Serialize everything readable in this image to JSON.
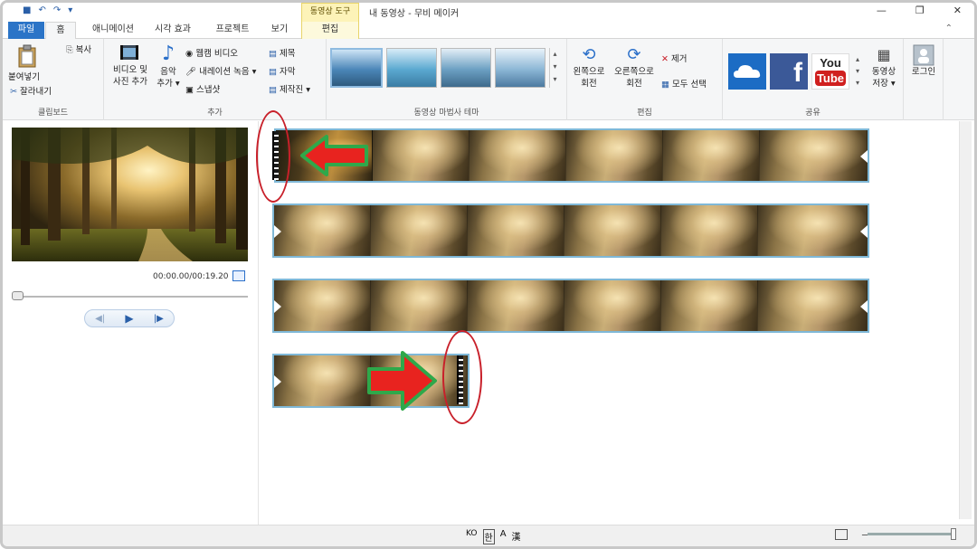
{
  "window": {
    "title": "내 동영상 - 무비 메이커",
    "tool_tab_header": "동영상 도구",
    "minimize": "—",
    "restore": "❐",
    "close": "✕",
    "collapse_ribbon": "⌃"
  },
  "quick_access": {
    "save": "■",
    "undo": "↶",
    "redo": "↷",
    "customize": "▾"
  },
  "tabs": {
    "file": "파일",
    "home": "홈",
    "animation": "애니메이션",
    "visual_effects": "시각 효과",
    "project": "프로젝트",
    "view": "보기",
    "edit": "편집"
  },
  "ribbon": {
    "clipboard": {
      "label": "클립보드",
      "paste": "붙여넣기",
      "copy": "복사",
      "cut": "잘라내기"
    },
    "add": {
      "label": "추가",
      "add_video_photo_1": "비디오 및",
      "add_video_photo_2": "사진 추가",
      "music_1": "음악",
      "music_2": "추가 ▾",
      "webcam": "웹캠 비디오",
      "narration": "내레이션 녹음 ▾",
      "snapshot": "스냅샷",
      "title": "제목",
      "caption": "자막",
      "credits": "제작진 ▾"
    },
    "themes": {
      "label": "동영상 마법사 테마"
    },
    "editing": {
      "label": "편집",
      "rotate_left_1": "왼쪽으로",
      "rotate_left_2": "회전",
      "rotate_right_1": "오른쪽으로",
      "rotate_right_2": "회전",
      "remove": "제거",
      "select_all": "모두 선택"
    },
    "share": {
      "label": "공유",
      "save_movie_1": "동영상",
      "save_movie_2": "저장 ▾",
      "login": "로그인",
      "facebook_letter": "f",
      "youtube_top": "You",
      "youtube_bottom": "Tube"
    }
  },
  "player": {
    "timecode": "00:00.00/00:19.20",
    "prev_frame": "◀|",
    "play": "▶",
    "next_frame": "|▶"
  },
  "statusbar": {
    "ime_lang": "KO",
    "ime_mode": "한",
    "ime_extra_1": "A",
    "ime_extra_2": "漢",
    "zoom_out": "−"
  },
  "colors": {
    "file_tab": "#2b74c7",
    "strip_border": "#7fb8d7",
    "annotation_red": "#c8202a",
    "arrow_fill": "#e8231f",
    "arrow_border": "#2fa84a",
    "tool_tab": "#fdf3b8"
  }
}
